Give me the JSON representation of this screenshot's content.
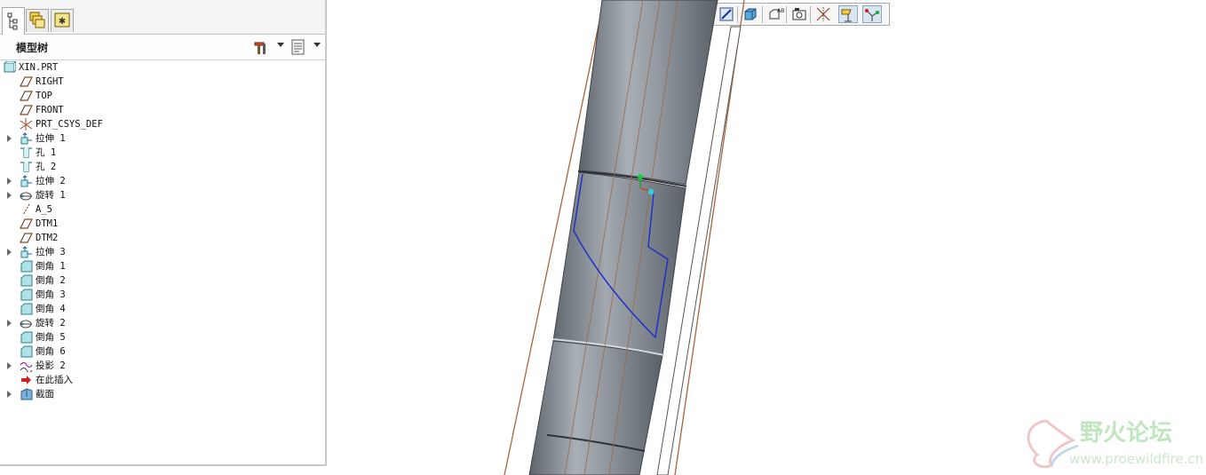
{
  "panel": {
    "tree_title": "模型树",
    "tabs": [
      "model-tree",
      "layers",
      "favorites"
    ]
  },
  "tree": [
    {
      "label": "XIN.PRT",
      "icon": "part-icon",
      "expandable": false,
      "indent": 0
    },
    {
      "label": "RIGHT",
      "icon": "datum-plane-icon",
      "expandable": false,
      "indent": 1
    },
    {
      "label": "TOP",
      "icon": "datum-plane-icon",
      "expandable": false,
      "indent": 1
    },
    {
      "label": "FRONT",
      "icon": "datum-plane-icon",
      "expandable": false,
      "indent": 1
    },
    {
      "label": "PRT_CSYS_DEF",
      "icon": "csys-icon",
      "expandable": false,
      "indent": 1
    },
    {
      "label": "拉伸 1",
      "icon": "extrude-icon",
      "expandable": true,
      "indent": 1
    },
    {
      "label": "孔 1",
      "icon": "hole-icon",
      "expandable": false,
      "indent": 1
    },
    {
      "label": "孔 2",
      "icon": "hole-icon",
      "expandable": false,
      "indent": 1
    },
    {
      "label": "拉伸 2",
      "icon": "extrude-icon",
      "expandable": true,
      "indent": 1
    },
    {
      "label": "旋转 1",
      "icon": "revolve-icon",
      "expandable": true,
      "indent": 1
    },
    {
      "label": "A_5",
      "icon": "datum-axis-icon",
      "expandable": false,
      "indent": 1
    },
    {
      "label": "DTM1",
      "icon": "datum-plane-icon",
      "expandable": false,
      "indent": 1
    },
    {
      "label": "DTM2",
      "icon": "datum-plane-icon",
      "expandable": false,
      "indent": 1
    },
    {
      "label": "拉伸 3",
      "icon": "extrude-icon",
      "expandable": true,
      "indent": 1
    },
    {
      "label": "倒角 1",
      "icon": "chamfer-icon",
      "expandable": false,
      "indent": 1
    },
    {
      "label": "倒角 2",
      "icon": "chamfer-icon",
      "expandable": false,
      "indent": 1
    },
    {
      "label": "倒角 3",
      "icon": "chamfer-icon",
      "expandable": false,
      "indent": 1
    },
    {
      "label": "倒角 4",
      "icon": "chamfer-icon",
      "expandable": false,
      "indent": 1
    },
    {
      "label": "旋转 2",
      "icon": "revolve-icon",
      "expandable": true,
      "indent": 1
    },
    {
      "label": "倒角 5",
      "icon": "chamfer-icon",
      "expandable": false,
      "indent": 1
    },
    {
      "label": "倒角 6",
      "icon": "chamfer-icon",
      "expandable": false,
      "indent": 1
    },
    {
      "label": "投影 2",
      "icon": "projection-icon",
      "expandable": true,
      "indent": 1
    },
    {
      "label": "在此插入",
      "icon": "insert-here-icon",
      "expandable": false,
      "indent": 1
    },
    {
      "label": "截面",
      "icon": "section-icon",
      "expandable": true,
      "indent": 1
    }
  ],
  "toolbar": {
    "buttons": [
      {
        "name": "refit-icon",
        "on": false
      },
      {
        "name": "zoom-in-icon",
        "on": false
      },
      {
        "name": "zoom-out-icon",
        "on": false
      },
      {
        "name": "repaint-icon",
        "on": false
      },
      {
        "name": "display-style-icon",
        "on": false
      },
      {
        "name": "saved-views-icon",
        "on": false
      },
      {
        "name": "view-manager-icon",
        "on": false
      },
      {
        "name": "csys-display-icon",
        "on": false
      },
      {
        "name": "datum-display-icon",
        "on": true
      },
      {
        "name": "point-display-icon",
        "on": true
      }
    ]
  },
  "watermark": {
    "title": "野火论坛",
    "url": "www.proewildfire.cn"
  },
  "colors": {
    "accent_blue": "#1a2ecc",
    "body_gray": "#8e949b",
    "edge_brown": "#a8653a"
  }
}
